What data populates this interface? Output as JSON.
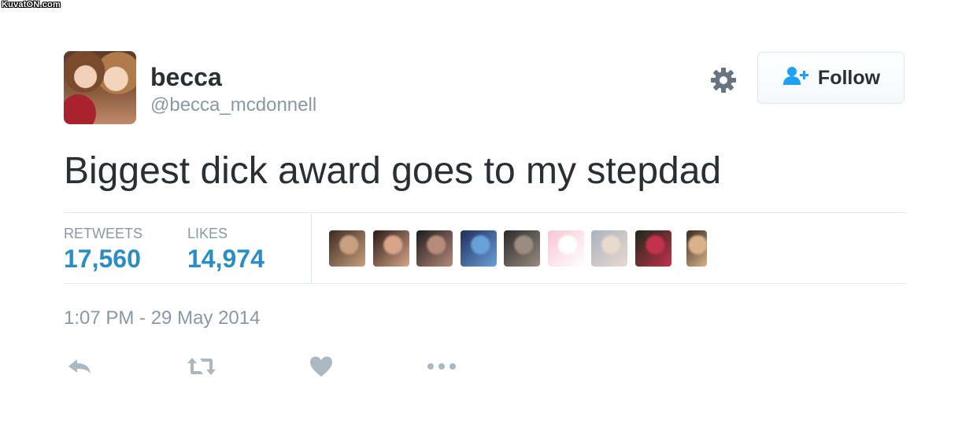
{
  "watermark": "KuvatON.com",
  "tweet": {
    "display_name": "becca",
    "handle": "@becca_mcdonnell",
    "text": "Biggest dick award goes to my stepdad",
    "timestamp": "1:07 PM - 29 May 2014"
  },
  "header": {
    "settings_icon": "gear-icon",
    "follow_label": "Follow",
    "follow_icon": "add-user-icon"
  },
  "stats": {
    "retweets_label": "RETWEETS",
    "retweets_value": "17,560",
    "likes_label": "LIKES",
    "likes_value": "14,974"
  },
  "likers": [
    {
      "name": "liker-avatar-1",
      "colors": [
        "#3b2a22",
        "#c9a07e"
      ]
    },
    {
      "name": "liker-avatar-2",
      "colors": [
        "#2b1b16",
        "#d7a58a"
      ]
    },
    {
      "name": "liker-avatar-3",
      "colors": [
        "#1d1b1e",
        "#b88a7a"
      ]
    },
    {
      "name": "liker-avatar-4",
      "colors": [
        "#1e2e5c",
        "#6aa0d8"
      ]
    },
    {
      "name": "liker-avatar-5",
      "colors": [
        "#2a2a2a",
        "#9b8c80"
      ]
    },
    {
      "name": "liker-avatar-6",
      "colors": [
        "#f7c6d4",
        "#ffffff"
      ]
    },
    {
      "name": "liker-avatar-7",
      "colors": [
        "#a9b3bf",
        "#e8d9cf"
      ]
    },
    {
      "name": "liker-avatar-8",
      "colors": [
        "#1b2a1a",
        "#c2324a"
      ]
    },
    {
      "name": "liker-avatar-9",
      "colors": [
        "#3a2a20",
        "#d9b28a"
      ]
    }
  ],
  "actions": {
    "reply_icon": "reply-icon",
    "retweet_icon": "retweet-icon",
    "like_icon": "heart-icon",
    "more_icon": "more-icon"
  },
  "colors": {
    "text": "#292f33",
    "muted": "#8899a6",
    "stat_value": "#2a8dc4",
    "follow_icon": "#1da1f2",
    "border": "#e1e8ed"
  }
}
